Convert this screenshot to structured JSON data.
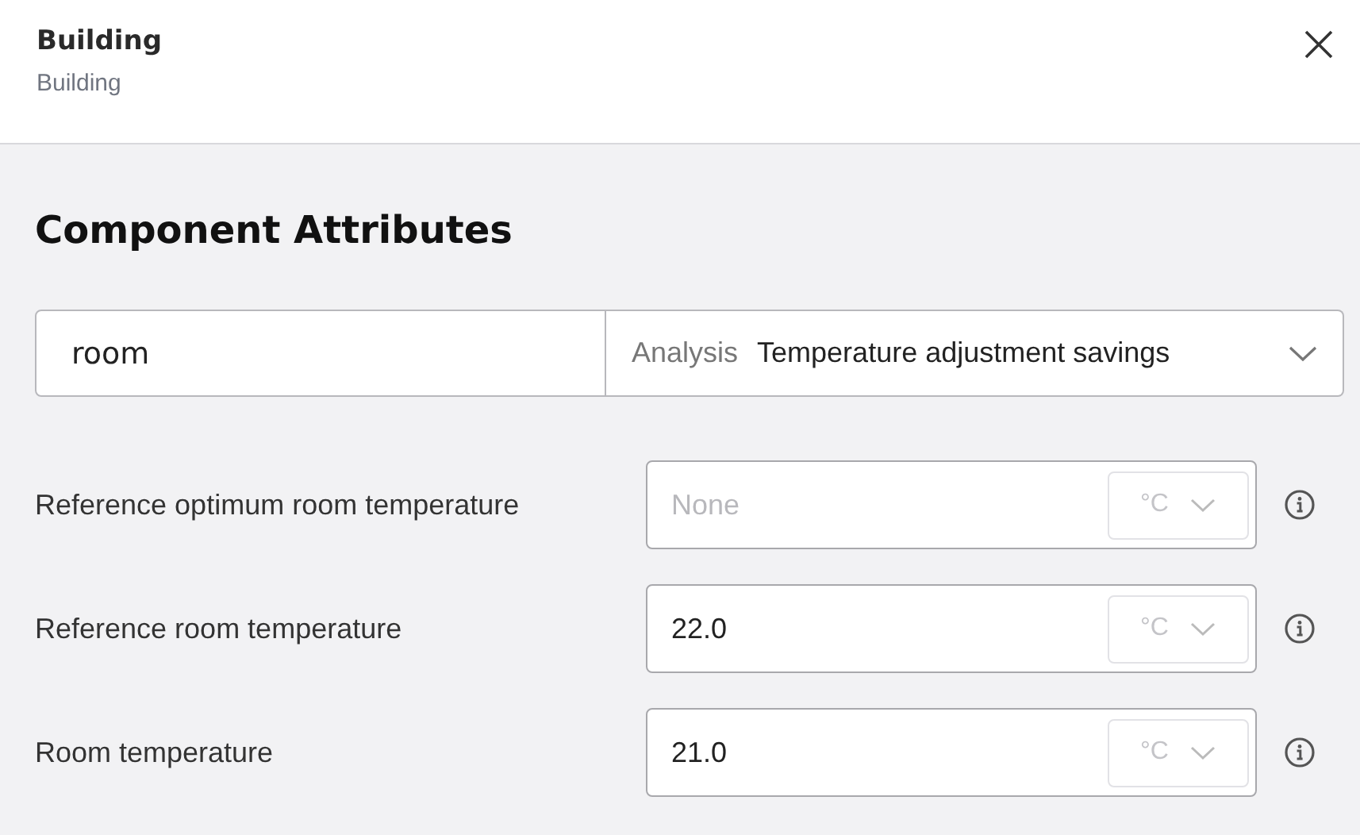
{
  "header": {
    "title": "Building",
    "subtitle": "Building"
  },
  "section_title": "Component Attributes",
  "selector": {
    "value": "room",
    "label": "Analysis",
    "selected_option": "Temperature adjustment savings"
  },
  "attributes": [
    {
      "label": "Reference optimum room temperature",
      "placeholder": "None",
      "unit": "°C",
      "unit_disabled": true
    },
    {
      "label": "Reference room temperature",
      "value": "22.0",
      "unit": "°C",
      "unit_disabled": true
    },
    {
      "label": "Room temperature",
      "value": "21.0",
      "unit": "°C",
      "unit_disabled": true
    }
  ]
}
